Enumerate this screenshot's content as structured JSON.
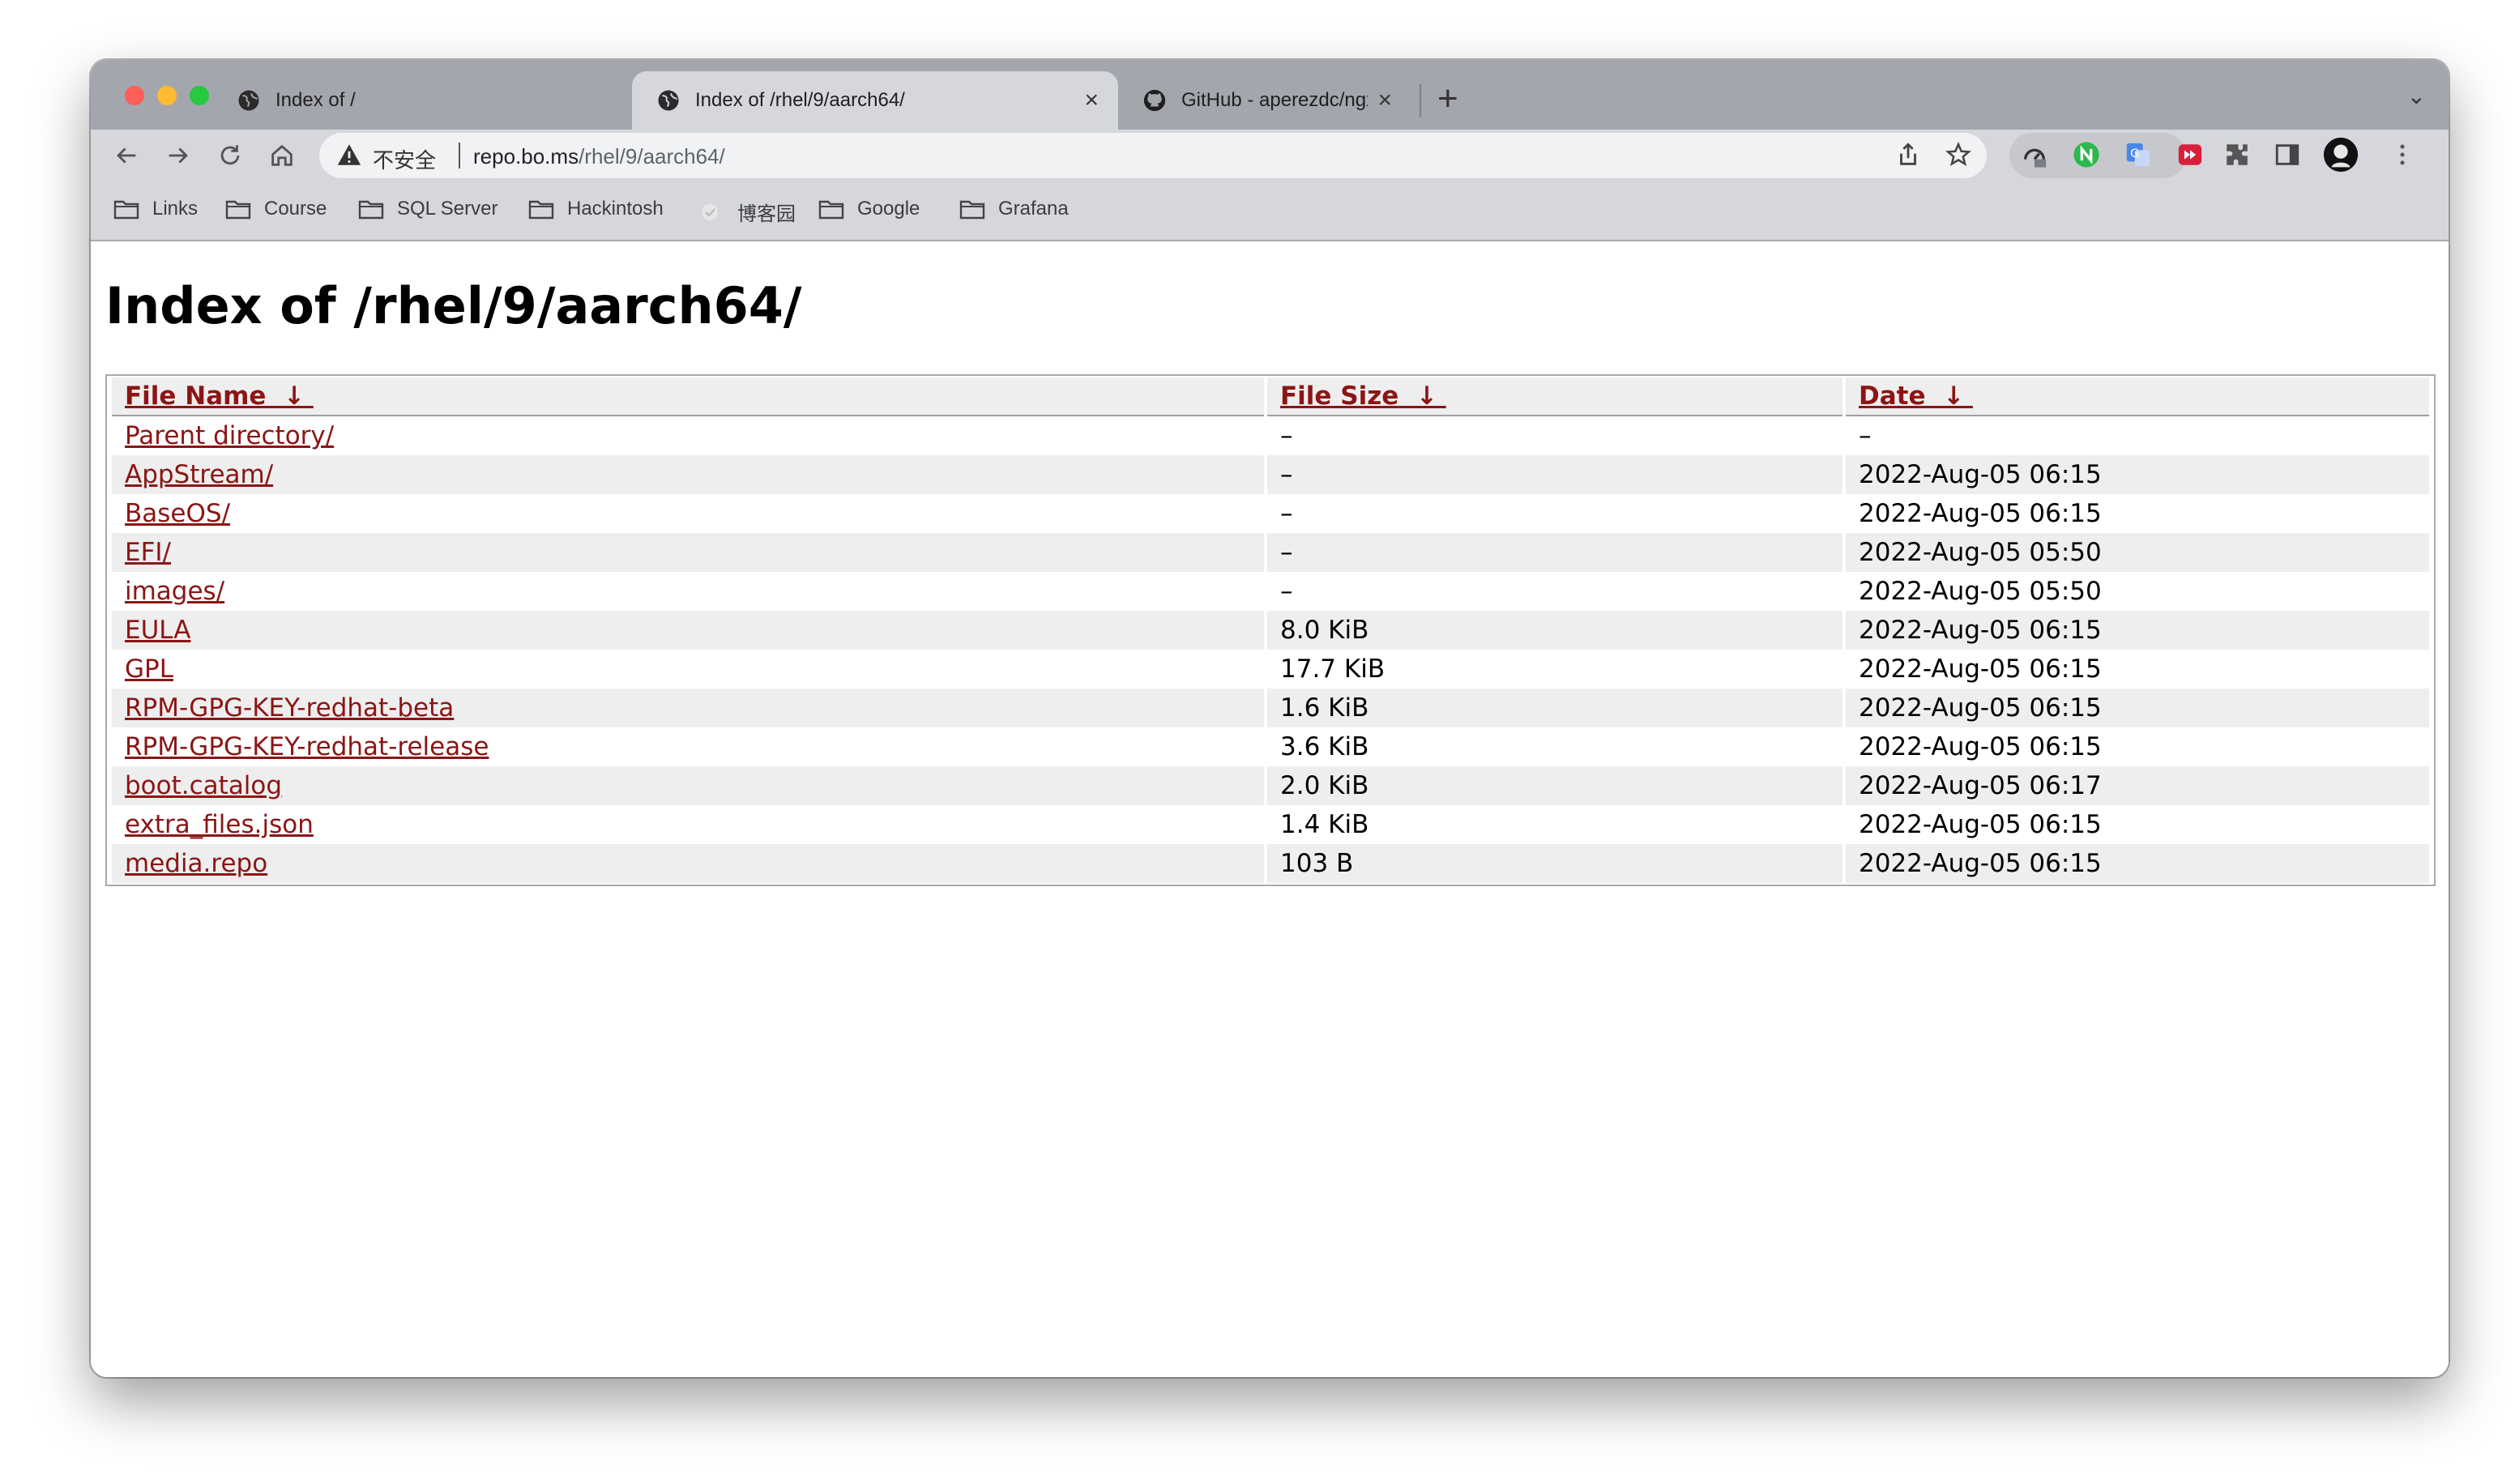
{
  "browser": {
    "tabs": [
      {
        "title": "Index of /",
        "close": "×",
        "active": false
      },
      {
        "title": "Index of /rhel/9/aarch64/",
        "close": "×",
        "active": true
      },
      {
        "title": "GitHub - aperezdc/ngx-fancyin",
        "close": "×",
        "active": false
      }
    ],
    "new_tab": "+",
    "tab_search": "⌄",
    "address": {
      "security_label": "不安全",
      "host": "repo.bo.ms",
      "path": "/rhel/9/aarch64/"
    },
    "bookmarks": [
      {
        "label": "Links",
        "icon": "folder-icon"
      },
      {
        "label": "Course",
        "icon": "folder-icon"
      },
      {
        "label": "SQL Server",
        "icon": "folder-icon"
      },
      {
        "label": "Hackintosh",
        "icon": "folder-icon"
      },
      {
        "label": "博客园",
        "icon": "site-icon"
      },
      {
        "label": "Google",
        "icon": "folder-icon"
      },
      {
        "label": "Grafana",
        "icon": "folder-icon"
      }
    ]
  },
  "page": {
    "title": "Index of /rhel/9/aarch64/",
    "columns": [
      {
        "label": "File Name",
        "sort": "↓"
      },
      {
        "label": "File Size",
        "sort": "↓"
      },
      {
        "label": "Date",
        "sort": "↓"
      }
    ],
    "rows": [
      {
        "name": "Parent directory/",
        "size": "–",
        "date": "–"
      },
      {
        "name": "AppStream/",
        "size": "–",
        "date": "2022-Aug-05 06:15"
      },
      {
        "name": "BaseOS/",
        "size": "–",
        "date": "2022-Aug-05 06:15"
      },
      {
        "name": "EFI/",
        "size": "–",
        "date": "2022-Aug-05 05:50"
      },
      {
        "name": "images/",
        "size": "–",
        "date": "2022-Aug-05 05:50"
      },
      {
        "name": "EULA",
        "size": "8.0 KiB",
        "date": "2022-Aug-05 06:15"
      },
      {
        "name": "GPL",
        "size": "17.7 KiB",
        "date": "2022-Aug-05 06:15"
      },
      {
        "name": "RPM-GPG-KEY-redhat-beta",
        "size": "1.6 KiB",
        "date": "2022-Aug-05 06:15"
      },
      {
        "name": "RPM-GPG-KEY-redhat-release",
        "size": "3.6 KiB",
        "date": "2022-Aug-05 06:15"
      },
      {
        "name": "boot.catalog",
        "size": "2.0 KiB",
        "date": "2022-Aug-05 06:17"
      },
      {
        "name": "extra_files.json",
        "size": "1.4 KiB",
        "date": "2022-Aug-05 06:15"
      },
      {
        "name": "media.repo",
        "size": "103 B",
        "date": "2022-Aug-05 06:15"
      }
    ]
  },
  "colors": {
    "link": "#8b1515",
    "header_bg": "#eeeeee",
    "tabstrip_bg": "#a4a6ae",
    "toolbar_bg": "#d5d7dd"
  }
}
